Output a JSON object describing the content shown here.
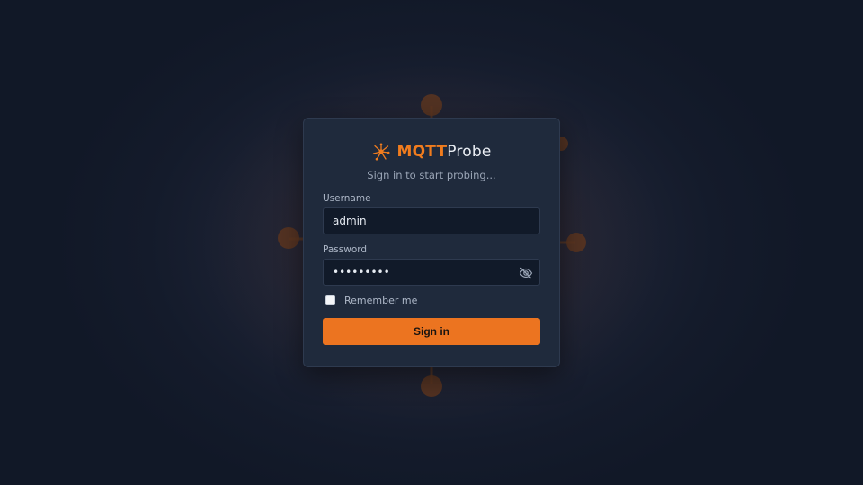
{
  "brand": {
    "name_accent": "MQTT",
    "name_rest": "Probe",
    "icon": "spark-probe-icon",
    "accent_color": "#f07c1e"
  },
  "tagline": "Sign in to start probing...",
  "form": {
    "username_label": "Username",
    "username_value": "admin",
    "password_label": "Password",
    "password_value": "password1",
    "password_toggle_icon": "eye-off-icon",
    "remember_label": "Remember me",
    "remember_checked": false,
    "submit_label": "Sign in"
  },
  "colors": {
    "background": "#141b2b",
    "card": "#1f2a3c",
    "button": "#ec7420"
  }
}
